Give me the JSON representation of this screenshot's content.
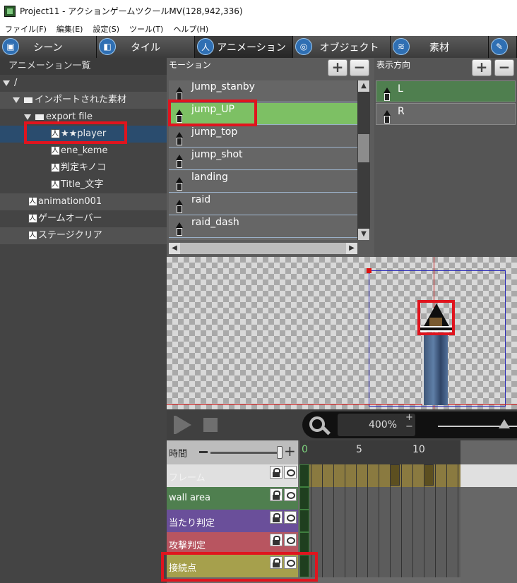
{
  "window": {
    "title": "Project11 - アクションゲームツクールMV(128,942,336)"
  },
  "menu": [
    "ファイル(F)",
    "編集(E)",
    "設定(S)",
    "ツール(T)",
    "ヘルプ(H)"
  ],
  "toolbar": {
    "scene": "シーン",
    "tile": "タイル",
    "animation": "アニメーション",
    "object": "オブジェクト",
    "material": "素材"
  },
  "tree": {
    "header": "アニメーション一覧",
    "root": "/",
    "imported": "インポートされた素材",
    "export_folder": "export file",
    "player": "★★player",
    "ene_keme": "ene_keme",
    "hantei_kinoko": "判定キノコ",
    "title_moji": "Title_文字",
    "animation001": "animation001",
    "gameover": "ゲームオーバー",
    "stage_clear": "ステージクリア"
  },
  "motion": {
    "title": "モーション",
    "add": "+",
    "remove": "−",
    "items": [
      "Jump_stanby",
      "jump_UP",
      "jump_top",
      "jump_shot",
      "landing",
      "raid",
      "raid_dash"
    ],
    "selected": "jump_UP"
  },
  "direction": {
    "title": "表示方向",
    "add": "+",
    "remove": "−",
    "items": [
      "L",
      "R"
    ],
    "selected": "L"
  },
  "playback": {
    "zoom": "400%",
    "plus": "+",
    "minus": "−"
  },
  "timeline": {
    "time_label": "時間",
    "plus": "+",
    "ruler": [
      "0",
      "5",
      "10"
    ],
    "layers": [
      "フレーム",
      "wall area",
      "当たり判定",
      "攻撃判定",
      "接続点"
    ]
  },
  "colors": {
    "selected_motion": "#7dc064",
    "selected_direction": "#4f7f4f",
    "tree_selected": "#2a4c6e",
    "annotation_red": "#e0141e",
    "layer_wall_area": "#4f7f4f",
    "layer_atari": "#6a4f9a",
    "layer_kougeki": "#b85560",
    "layer_setsuzoku": "#a6a04c"
  }
}
